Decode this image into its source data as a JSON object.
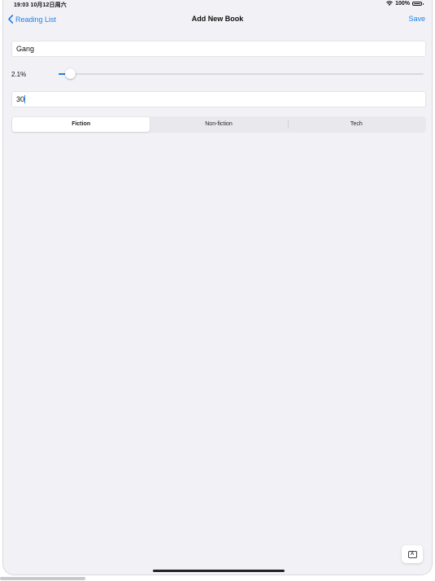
{
  "status_bar": {
    "time": "19:03  10月12日周六",
    "battery": "100%"
  },
  "nav": {
    "back_label": "Reading List",
    "title": "Add New Book",
    "save_label": "Save"
  },
  "form": {
    "title_value": "Gang",
    "rating": {
      "label": "2.1%",
      "value_fraction": 0.032
    },
    "pages_value": "30",
    "genres": {
      "options": [
        "Fiction",
        "Non-fiction",
        "Tech"
      ],
      "selected": "Fiction"
    }
  },
  "keyboard_button": {
    "glyph": "A"
  },
  "colors": {
    "accent": "#1f7fe6",
    "background": "#f2f2f6"
  },
  "icons": {
    "back": "chevron-left-icon",
    "wifi": "wifi-icon",
    "battery": "battery-icon",
    "keyboard": "keyboard-icon"
  }
}
